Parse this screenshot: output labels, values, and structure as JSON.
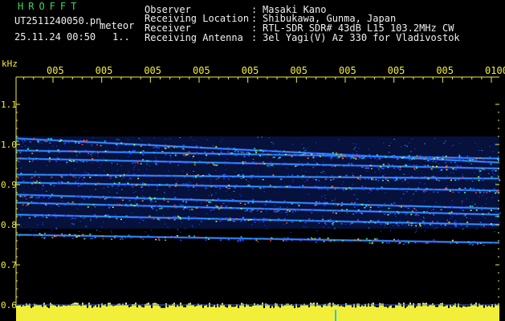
{
  "header": {
    "title": "HROFFT",
    "filename": "UT2511240050.pn",
    "tag": "meteor",
    "datetime": "25.11.24 00:50",
    "count": "1.."
  },
  "info": [
    {
      "label": "Observer",
      "value": "Masaki Kano"
    },
    {
      "label": "Receiving Location",
      "value": "Shibukawa, Gunma, Japan"
    },
    {
      "label": "Receiver",
      "value": "RTL-SDR SDR# 43dB L15 103.2MHz CW"
    },
    {
      "label": "Receiving Antenna",
      "value": "3el Yagi(V) Az 330 for Vladivostok"
    }
  ],
  "colors": {
    "title": "#39d95a",
    "text": "#f0f0f0",
    "axis": "#f2ef3a",
    "background": "#000000"
  },
  "chart_data": {
    "type": "heatmap",
    "yunit": "kHz",
    "ylim": [
      0.6,
      1.2
    ],
    "yticks": [
      "1.1",
      "1.0",
      "0.9",
      "0.8",
      "0.7",
      "0.6"
    ],
    "ytick_values": [
      1.1,
      1.0,
      0.9,
      0.8,
      0.7,
      0.6
    ],
    "xticks": [
      "005",
      "005",
      "005",
      "005",
      "005",
      "005",
      "005",
      "005",
      "005",
      "0100"
    ],
    "xtick_truncated": [
      true,
      true,
      true,
      true,
      true,
      true,
      true,
      true,
      true,
      false
    ],
    "bands": [
      {
        "f0": 1.015,
        "f1": 0.955
      },
      {
        "f0": 0.985,
        "f1": 0.965
      },
      {
        "f0": 0.965,
        "f1": 0.94
      },
      {
        "f0": 0.925,
        "f1": 0.915
      },
      {
        "f0": 0.905,
        "f1": 0.885
      },
      {
        "f0": 0.875,
        "f1": 0.84
      },
      {
        "f0": 0.855,
        "f1": 0.825
      },
      {
        "f0": 0.825,
        "f1": 0.8
      },
      {
        "f0": 0.775,
        "f1": 0.755
      }
    ]
  }
}
